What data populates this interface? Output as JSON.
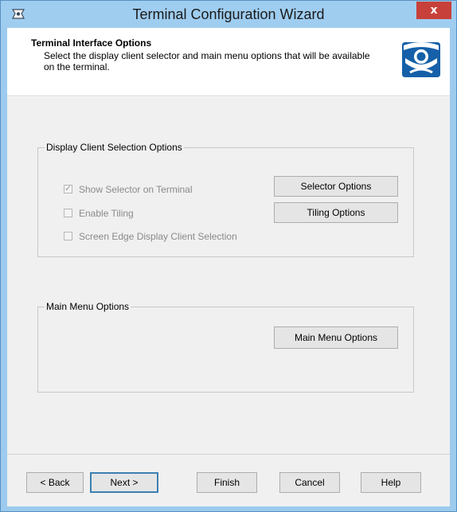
{
  "window": {
    "title": "Terminal Configuration Wizard",
    "close_label": "x"
  },
  "header": {
    "title": "Terminal Interface Options",
    "subtitle": "Select the display client selector and main menu options that will be available on the terminal."
  },
  "display_client_group": {
    "legend": "Display Client Selection Options",
    "checkboxes": [
      {
        "label": "Show Selector on Terminal",
        "checked": true,
        "enabled": false
      },
      {
        "label": "Enable Tiling",
        "checked": false,
        "enabled": false
      },
      {
        "label": "Screen Edge Display Client Selection",
        "checked": false,
        "enabled": false
      }
    ],
    "selector_options_label": "Selector Options",
    "tiling_options_label": "Tiling Options"
  },
  "main_menu_group": {
    "legend": "Main Menu Options",
    "button_label": "Main Menu Options"
  },
  "footer": {
    "back_label": "< Back",
    "next_label": "Next >",
    "finish_label": "Finish",
    "cancel_label": "Cancel",
    "help_label": "Help"
  },
  "icons": {
    "app": "wizard-icon",
    "logo": "thinmanager-logo-icon",
    "close": "close-icon"
  },
  "colors": {
    "titlebar": "#9fcdf0",
    "close": "#c7413a",
    "logo_blue": "#1560a8"
  }
}
